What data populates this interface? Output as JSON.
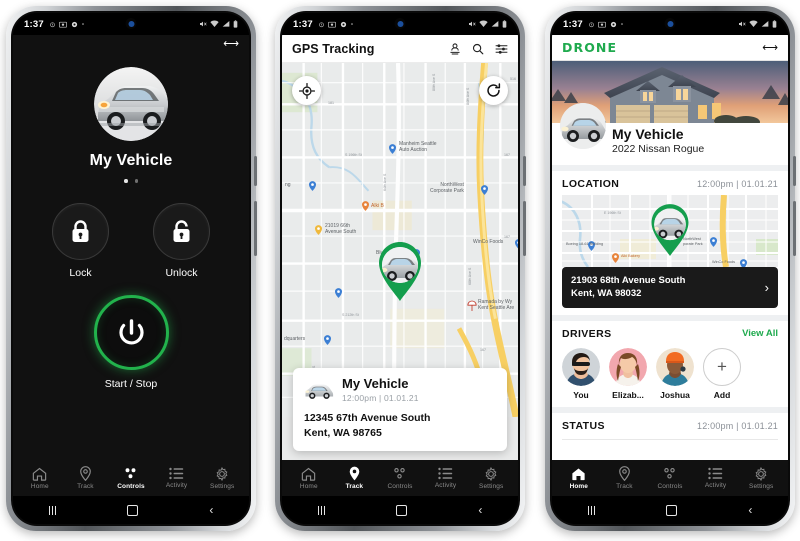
{
  "status_bar": {
    "time": "1:37",
    "left_icons": [
      "alarm-icon",
      "screenshot-icon",
      "location-icon",
      "dot-icon"
    ],
    "right_icons": [
      "mute-icon",
      "wifi-icon",
      "signal-icon",
      "battery-icon"
    ]
  },
  "android_nav": {
    "recents": "recents-button",
    "home": "home-button",
    "back": "back-button"
  },
  "bottom_nav": {
    "items": [
      {
        "label": "Home",
        "icon": "home-icon"
      },
      {
        "label": "Track",
        "icon": "map-pin-icon"
      },
      {
        "label": "Controls",
        "icon": "controls-dots-icon"
      },
      {
        "label": "Activity",
        "icon": "list-icon"
      },
      {
        "label": "Settings",
        "icon": "gear-icon"
      }
    ]
  },
  "phone1": {
    "active_tab": "Controls",
    "resize_icon": "resize-arrows-icon",
    "vehicle_name": "My Vehicle",
    "vehicle_image": "vehicle-photo",
    "pager_dots": 2,
    "pager_active_index": 0,
    "lock_button": {
      "label": "Lock",
      "icon": "lock-closed-icon"
    },
    "unlock_button": {
      "label": "Unlock",
      "icon": "lock-open-icon"
    },
    "start_stop": {
      "label": "Start / Stop",
      "icon": "power-icon",
      "ring_color": "#22b24c"
    }
  },
  "phone2": {
    "active_tab": "Track",
    "header": {
      "title": "GPS Tracking",
      "icons": [
        "person-location-icon",
        "search-icon",
        "filter-sliders-icon"
      ]
    },
    "map": {
      "recenter_icon": "crosshair-icon",
      "refresh_icon": "refresh-icon",
      "vehicle_marker": "vehicle-map-marker",
      "labels": [
        "Manheim Seattle\nAuto Auction",
        "NorthWest\nCorporate Park",
        "WinCo Foods",
        "21019 66th\nAvenue South",
        "Alki B",
        "Blue Origin",
        "Ramada by Wy\nKent Seattle Are",
        "dquarters",
        "ng"
      ],
      "streets": [
        "S 196th St",
        "S 212th St",
        "80th Ave S",
        "84th Ave S",
        "68th Ave S",
        "64th Ave S"
      ],
      "highways": [
        "181",
        "167",
        "167",
        "167",
        "516"
      ]
    },
    "card": {
      "vehicle_name": "My Vehicle",
      "timestamp": "12:00pm | 01.01.21",
      "address_line1": "12345 67th Avenue South",
      "address_line2": "Kent, WA 98765"
    }
  },
  "phone3": {
    "active_tab": "Home",
    "logo": "DRONE",
    "logo_color": "#1faa4e",
    "resize_icon": "resize-arrows-icon",
    "hero_image": "house-at-dusk-photo",
    "vehicle": {
      "name": "My Vehicle",
      "model": "2022 Nissan Rogue",
      "avatar": "vehicle-photo"
    },
    "location": {
      "title": "LOCATION",
      "timestamp": "12:00pm | 01.01.21",
      "map_marker": "vehicle-map-marker",
      "address_line1": "21903 68th Avenue South",
      "address_line2": "Kent, WA 98032",
      "chevron": "chevron-right-icon",
      "map_labels": [
        "Boeing 18-61 Building",
        "Alki Bakery",
        "NorthWest Corporate Park",
        "WinCo Foods",
        "E 196th St"
      ]
    },
    "drivers": {
      "title": "DRIVERS",
      "view_all": "View All",
      "list": [
        {
          "name": "You",
          "avatar": "driver-avatar-you",
          "bg": "#cfd4d8"
        },
        {
          "name": "Elizab...",
          "avatar": "driver-avatar-elizabeth",
          "bg": "#f2a7ae"
        },
        {
          "name": "Joshua",
          "avatar": "driver-avatar-joshua",
          "bg": "#efe2cf"
        },
        {
          "name": "Add",
          "avatar": "plus-icon",
          "bg": "#ffffff"
        }
      ]
    },
    "status": {
      "title": "STATUS",
      "timestamp": "12:00pm | 01.01.21"
    }
  }
}
